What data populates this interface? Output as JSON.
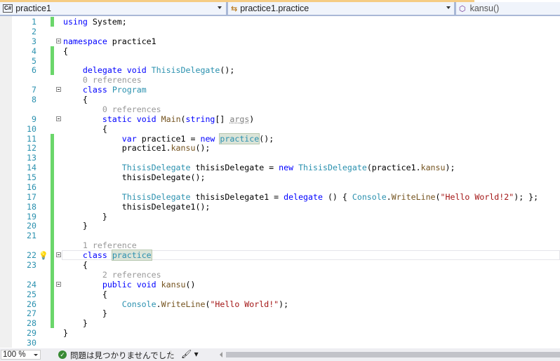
{
  "nav": {
    "project": {
      "badge": "C#",
      "label": "practice1"
    },
    "class": {
      "icon": "class-icon",
      "label": "practice1.practice"
    },
    "member": {
      "icon": "method-cube-icon",
      "label": "kansu()"
    }
  },
  "editor": {
    "rows": [
      {
        "n": "1",
        "chg": true,
        "t": [
          [
            "kw",
            "using"
          ],
          [
            "pl",
            " System;"
          ]
        ]
      },
      {
        "n": "2",
        "t": []
      },
      {
        "n": "3",
        "fold": true,
        "t": [
          [
            "kw",
            "namespace"
          ],
          [
            "pl",
            " practice1"
          ]
        ]
      },
      {
        "n": "4",
        "chg": true,
        "t": [
          [
            "pl",
            "{"
          ]
        ]
      },
      {
        "n": "5",
        "chg": true,
        "t": []
      },
      {
        "n": "6",
        "chg": true,
        "t": [
          [
            "pl",
            "    "
          ],
          [
            "kw",
            "delegate"
          ],
          [
            "pl",
            " "
          ],
          [
            "kw",
            "void"
          ],
          [
            "pl",
            " "
          ],
          [
            "ty",
            "ThisisDelegate"
          ],
          [
            "pl",
            "();"
          ]
        ]
      },
      {
        "lens": "    0 references"
      },
      {
        "n": "7",
        "fold": true,
        "t": [
          [
            "pl",
            "    "
          ],
          [
            "kw",
            "class"
          ],
          [
            "pl",
            " "
          ],
          [
            "ty",
            "Program"
          ]
        ]
      },
      {
        "n": "8",
        "t": [
          [
            "pl",
            "    {"
          ]
        ]
      },
      {
        "lens": "        0 references"
      },
      {
        "n": "9",
        "fold": true,
        "t": [
          [
            "pl",
            "        "
          ],
          [
            "kw",
            "static"
          ],
          [
            "pl",
            " "
          ],
          [
            "kw",
            "void"
          ],
          [
            "pl",
            " "
          ],
          [
            "me",
            "Main"
          ],
          [
            "pl",
            "("
          ],
          [
            "kw",
            "string"
          ],
          [
            "pl",
            "[] "
          ],
          [
            "un",
            "args"
          ],
          [
            "pl",
            ")"
          ]
        ]
      },
      {
        "n": "10",
        "t": [
          [
            "pl",
            "        {"
          ]
        ]
      },
      {
        "n": "11",
        "chg": true,
        "t": [
          [
            "pl",
            "            "
          ],
          [
            "kw",
            "var"
          ],
          [
            "pl",
            " practice1 = "
          ],
          [
            "kw",
            "new"
          ],
          [
            "pl",
            " "
          ],
          [
            "ty hl",
            "practice"
          ],
          [
            "pl",
            "();"
          ]
        ]
      },
      {
        "n": "12",
        "chg": true,
        "t": [
          [
            "pl",
            "            practice1."
          ],
          [
            "me",
            "kansu"
          ],
          [
            "pl",
            "();"
          ]
        ]
      },
      {
        "n": "13",
        "chg": true,
        "t": []
      },
      {
        "n": "14",
        "chg": true,
        "t": [
          [
            "pl",
            "            "
          ],
          [
            "ty",
            "ThisisDelegate"
          ],
          [
            "pl",
            " thisisDelegate = "
          ],
          [
            "kw",
            "new"
          ],
          [
            "pl",
            " "
          ],
          [
            "ty",
            "ThisisDelegate"
          ],
          [
            "pl",
            "(practice1."
          ],
          [
            "me",
            "kansu"
          ],
          [
            "pl",
            ");"
          ]
        ]
      },
      {
        "n": "15",
        "chg": true,
        "t": [
          [
            "pl",
            "            thisisDelegate();"
          ]
        ]
      },
      {
        "n": "16",
        "chg": true,
        "t": []
      },
      {
        "n": "17",
        "chg": true,
        "t": [
          [
            "pl",
            "            "
          ],
          [
            "ty",
            "ThisisDelegate"
          ],
          [
            "pl",
            " thisisDelegate1 = "
          ],
          [
            "kw",
            "delegate"
          ],
          [
            "pl",
            " () { "
          ],
          [
            "ty",
            "Console"
          ],
          [
            "pl",
            "."
          ],
          [
            "me",
            "WriteLine"
          ],
          [
            "pl",
            "("
          ],
          [
            "st",
            "\"Hello World!2\""
          ],
          [
            "pl",
            "); };"
          ]
        ]
      },
      {
        "n": "18",
        "chg": true,
        "t": [
          [
            "pl",
            "            thisisDelegate1();"
          ]
        ]
      },
      {
        "n": "19",
        "chg": true,
        "t": [
          [
            "pl",
            "        }"
          ]
        ]
      },
      {
        "n": "20",
        "chg": true,
        "t": [
          [
            "pl",
            "    }"
          ]
        ]
      },
      {
        "n": "21",
        "chg": true,
        "t": []
      },
      {
        "lens": "    1 reference",
        "chg": true
      },
      {
        "n": "22",
        "chg": true,
        "fold": true,
        "bulb": true,
        "cur": true,
        "t": [
          [
            "pl",
            "    "
          ],
          [
            "kw",
            "class"
          ],
          [
            "pl",
            " "
          ],
          [
            "ty hl",
            "practice"
          ]
        ]
      },
      {
        "n": "23",
        "chg": true,
        "t": [
          [
            "pl",
            "    {"
          ]
        ]
      },
      {
        "lens": "        2 references",
        "chg": true
      },
      {
        "n": "24",
        "chg": true,
        "fold": true,
        "t": [
          [
            "pl",
            "        "
          ],
          [
            "kw",
            "public"
          ],
          [
            "pl",
            " "
          ],
          [
            "kw",
            "void"
          ],
          [
            "pl",
            " "
          ],
          [
            "me",
            "kansu"
          ],
          [
            "pl",
            "()"
          ]
        ]
      },
      {
        "n": "25",
        "chg": true,
        "t": [
          [
            "pl",
            "        {"
          ]
        ]
      },
      {
        "n": "26",
        "chg": true,
        "t": [
          [
            "pl",
            "            "
          ],
          [
            "ty",
            "Console"
          ],
          [
            "pl",
            "."
          ],
          [
            "me",
            "WriteLine"
          ],
          [
            "pl",
            "("
          ],
          [
            "st",
            "\"Hello World!\""
          ],
          [
            "pl",
            ");"
          ]
        ]
      },
      {
        "n": "27",
        "chg": true,
        "t": [
          [
            "pl",
            "        }"
          ]
        ]
      },
      {
        "n": "28",
        "chg": true,
        "t": [
          [
            "pl",
            "    }"
          ]
        ]
      },
      {
        "n": "29",
        "t": [
          [
            "pl",
            "}"
          ]
        ]
      },
      {
        "n": "30",
        "t": []
      }
    ]
  },
  "status": {
    "zoom": "100 %",
    "issues_icon": "check-circle-icon",
    "issues": "問題は見つかりませんでした",
    "cleanup_icon": "brush-icon"
  }
}
